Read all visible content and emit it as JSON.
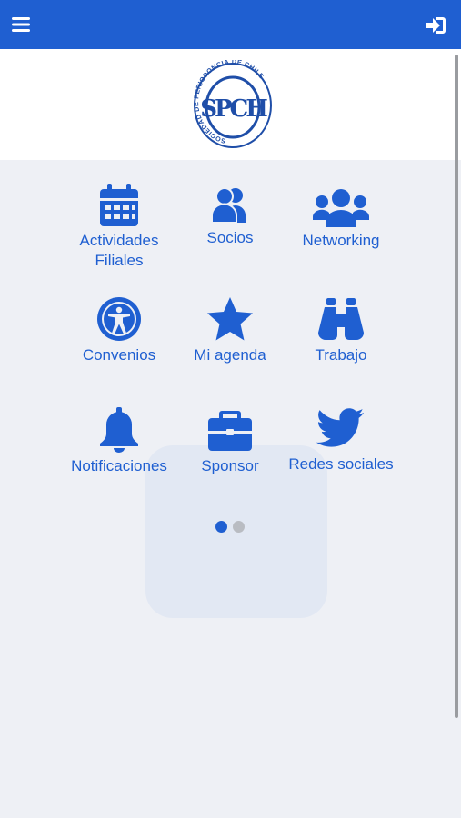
{
  "app": {
    "logo_text": "SPCH",
    "logo_ring_text": "SOCIEDAD DE PERIODONCIA DE CHILE",
    "accent_color": "#1f5fd1"
  },
  "header": {
    "menu_icon": "hamburger-menu-icon",
    "login_icon": "sign-in-icon"
  },
  "menu": {
    "items": [
      {
        "label": "Actividades Filiales",
        "icon": "calendar-icon"
      },
      {
        "label": "Socios",
        "icon": "user-friends-icon"
      },
      {
        "label": "Networking",
        "icon": "users-group-icon"
      },
      {
        "label": "Convenios",
        "icon": "universal-access-icon"
      },
      {
        "label": "Mi agenda",
        "icon": "star-icon"
      },
      {
        "label": "Trabajo",
        "icon": "binoculars-icon"
      },
      {
        "label": "Notificaciones",
        "icon": "bell-icon"
      },
      {
        "label": "Sponsor",
        "icon": "briefcase-icon"
      },
      {
        "label": "Redes sociales",
        "icon": "twitter-bird-icon"
      }
    ]
  },
  "pagination": {
    "pages": 2,
    "current": 1
  }
}
